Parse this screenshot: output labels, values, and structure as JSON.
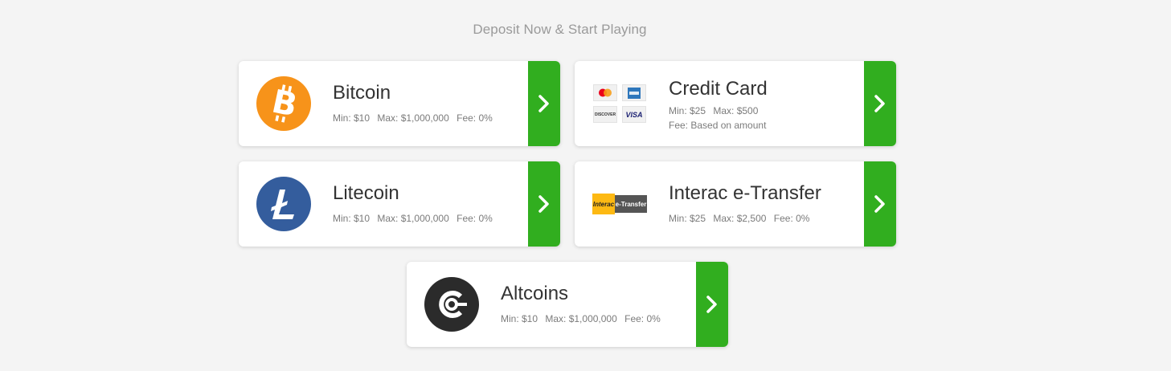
{
  "heading": "Deposit Now & Start Playing",
  "methods": {
    "bitcoin": {
      "title": "Bitcoin",
      "min": "Min: $10",
      "max": "Max: $1,000,000",
      "fee": "Fee: 0%"
    },
    "credit_card": {
      "title": "Credit Card",
      "min": "Min: $25",
      "max": "Max: $500",
      "fee": "Fee: Based on amount",
      "logos": {
        "discover": "DISCOVER",
        "visa": "VISA"
      }
    },
    "litecoin": {
      "title": "Litecoin",
      "min": "Min: $10",
      "max": "Max: $1,000,000",
      "fee": "Fee: 0%"
    },
    "interac": {
      "title": "Interac e-Transfer",
      "min": "Min: $25",
      "max": "Max: $2,500",
      "fee": "Fee: 0%",
      "logo": {
        "brand": "Interac",
        "product": "e-Transfer"
      }
    },
    "altcoins": {
      "title": "Altcoins",
      "min": "Min: $10",
      "max": "Max: $1,000,000",
      "fee": "Fee: 0%"
    }
  },
  "colors": {
    "arrow_bg": "#31ae1f",
    "bitcoin": "#f7931a",
    "litecoin": "#345d9d",
    "altcoins": "#2b2b2b"
  },
  "icons": {
    "arrow": "chevron-right-icon"
  }
}
